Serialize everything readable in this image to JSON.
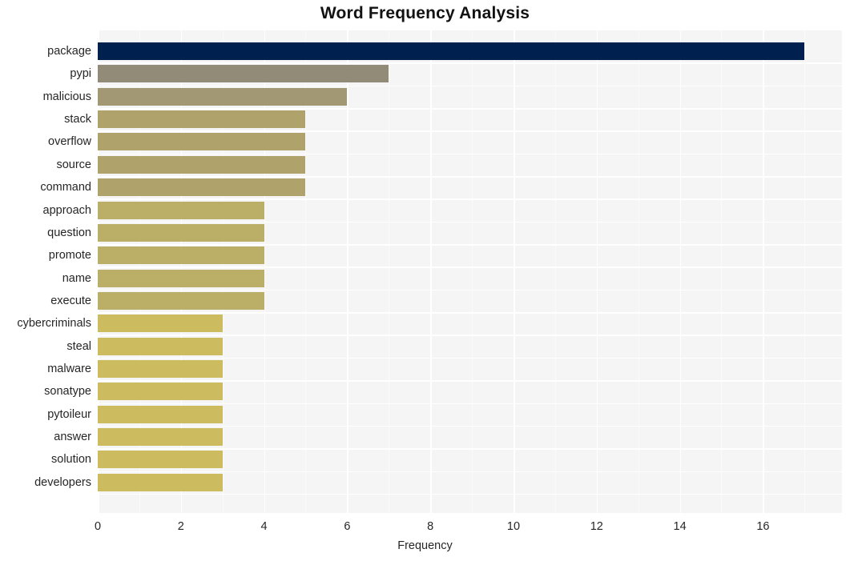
{
  "chart_data": {
    "type": "bar",
    "orientation": "horizontal",
    "title": "Word Frequency Analysis",
    "xlabel": "Frequency",
    "ylabel": "",
    "categories": [
      "package",
      "pypi",
      "malicious",
      "stack",
      "overflow",
      "source",
      "command",
      "approach",
      "question",
      "promote",
      "name",
      "execute",
      "cybercriminals",
      "steal",
      "malware",
      "sonatype",
      "pytoileur",
      "answer",
      "solution",
      "developers"
    ],
    "values": [
      17,
      7,
      6,
      5,
      5,
      5,
      5,
      4,
      4,
      4,
      4,
      4,
      3,
      3,
      3,
      3,
      3,
      3,
      3,
      3
    ],
    "xlim": [
      0,
      17.9
    ],
    "xticks": [
      0,
      2,
      4,
      6,
      8,
      10,
      12,
      14,
      16
    ],
    "xticklabels": [
      "0",
      "2",
      "4",
      "6",
      "8",
      "10",
      "12",
      "14",
      "16"
    ],
    "grid": true,
    "legend": false,
    "bar_colors": [
      "#002050",
      "#918b78",
      "#a29873",
      "#afa26b",
      "#afa26b",
      "#afa26b",
      "#afa26b",
      "#bbae67",
      "#bbae67",
      "#bbae67",
      "#bbae67",
      "#bbae67",
      "#cdbc5f",
      "#cdbc5f",
      "#cdbc5f",
      "#cdbc5f",
      "#cdbc5f",
      "#cdbc5f",
      "#cdbc5f",
      "#cdbc5f"
    ],
    "plot_background": "#f5f5f5",
    "figure_background": "#ffffff",
    "gridline_color": "#ffffff",
    "text_color": "#262626"
  }
}
